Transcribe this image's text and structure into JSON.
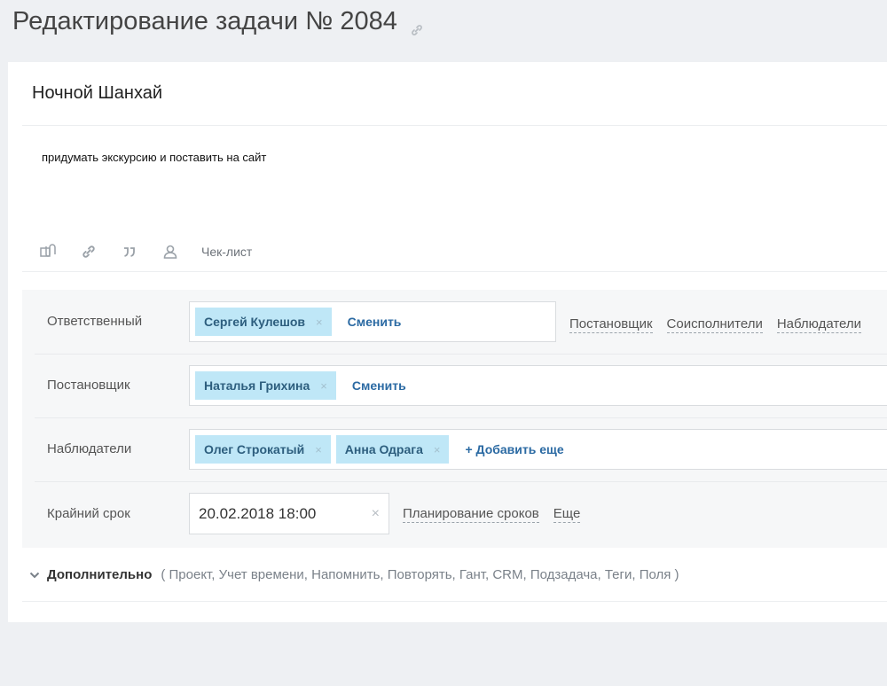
{
  "header": {
    "title": "Редактирование задачи № 2084",
    "link_icon": "link-icon"
  },
  "task": {
    "title": "Ночной Шанхай",
    "description": "придумать экскурсию и поставить на сайт"
  },
  "toolbar": {
    "icons": [
      "paperclip-icon",
      "link-icon",
      "quote-icon",
      "user-icon"
    ],
    "checklist_label": "Чек-лист"
  },
  "fields": {
    "responsible": {
      "label": "Ответственный",
      "chip": "Сергей Кулешов",
      "action": "Сменить",
      "roles": [
        "Постановщик",
        "Соисполнители",
        "Наблюдатели"
      ]
    },
    "creator": {
      "label": "Постановщик",
      "chip": "Наталья Грихина",
      "action": "Сменить"
    },
    "observers": {
      "label": "Наблюдатели",
      "chips": [
        "Олег Строкатый",
        "Анна Одрага"
      ],
      "action": "+ Добавить еще"
    },
    "deadline": {
      "label": "Крайний срок",
      "value": "20.02.2018 18:00",
      "planning": "Планирование сроков",
      "more": "Еще"
    },
    "remove_glyph": "×"
  },
  "extra": {
    "label": "Дополнительно",
    "items": "( Проект,  Учет времени,  Напомнить,  Повторять,  Гант,  CRM,  Подзадача,  Теги,  Поля )"
  },
  "colors": {
    "chip_bg": "#bfe7f7",
    "chip_text": "#2d5e7e",
    "link": "#2b6aa3",
    "page_bg": "#eef0f3"
  }
}
